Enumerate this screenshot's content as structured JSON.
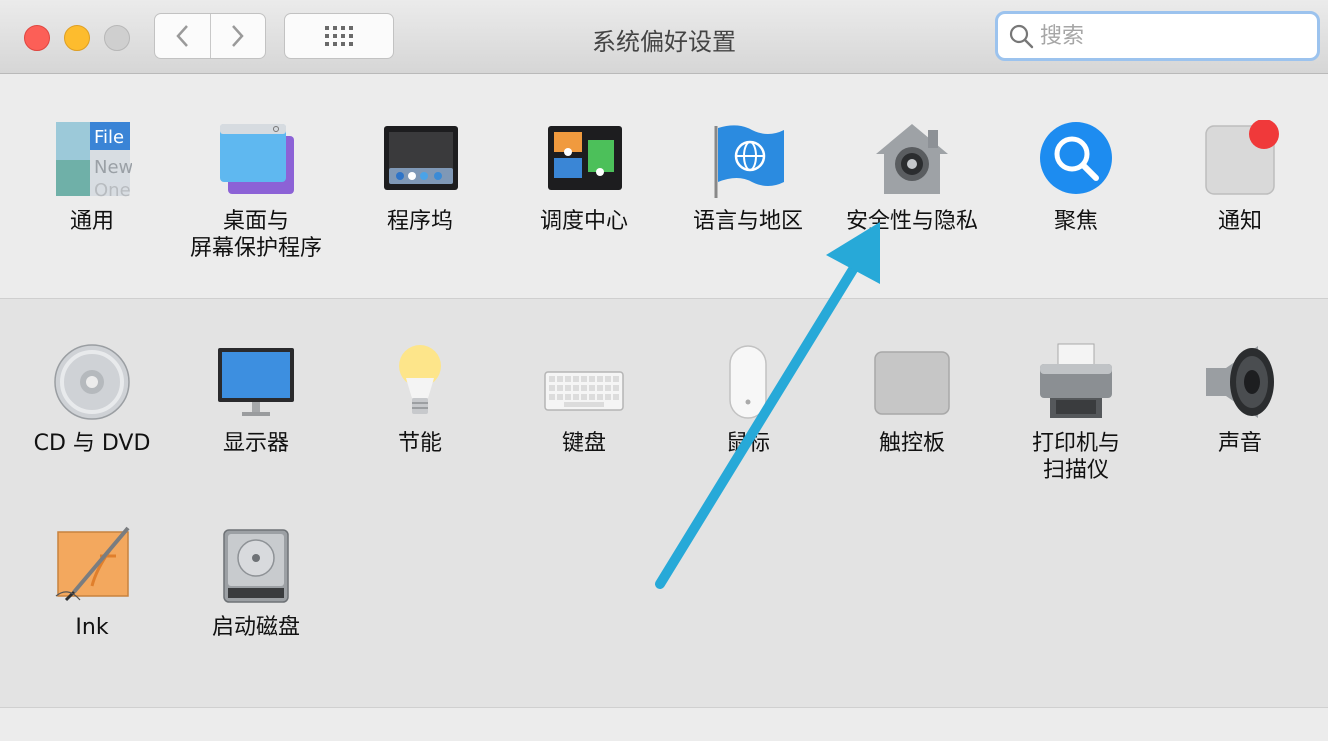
{
  "window": {
    "title": "系统偏好设置",
    "search_placeholder": "搜索"
  },
  "rows": [
    [
      {
        "id": "general",
        "label": "通用",
        "icon": "general-icon"
      },
      {
        "id": "desktop",
        "label": "桌面与\n屏幕保护程序",
        "icon": "desktop-screensaver-icon"
      },
      {
        "id": "dock",
        "label": "程序坞",
        "icon": "dock-icon"
      },
      {
        "id": "mission",
        "label": "调度中心",
        "icon": "mission-control-icon"
      },
      {
        "id": "language",
        "label": "语言与地区",
        "icon": "language-region-icon"
      },
      {
        "id": "security",
        "label": "安全性与隐私",
        "icon": "security-privacy-icon"
      },
      {
        "id": "spotlight",
        "label": "聚焦",
        "icon": "spotlight-icon"
      },
      {
        "id": "notifications",
        "label": "通知",
        "icon": "notifications-icon"
      }
    ],
    [
      {
        "id": "cd",
        "label": "CD 与 DVD",
        "icon": "cd-dvd-icon"
      },
      {
        "id": "display",
        "label": "显示器",
        "icon": "display-icon"
      },
      {
        "id": "energy",
        "label": "节能",
        "icon": "energy-saver-icon"
      },
      {
        "id": "keyboard",
        "label": "键盘",
        "icon": "keyboard-icon"
      },
      {
        "id": "mouse",
        "label": "鼠标",
        "icon": "mouse-icon"
      },
      {
        "id": "trackpad",
        "label": "触控板",
        "icon": "trackpad-icon"
      },
      {
        "id": "printer",
        "label": "打印机与\n扫描仪",
        "icon": "printer-scanner-icon"
      },
      {
        "id": "sound",
        "label": "声音",
        "icon": "sound-icon"
      }
    ],
    [
      {
        "id": "ink",
        "label": "Ink",
        "icon": "ink-icon"
      },
      {
        "id": "startup",
        "label": "启动磁盘",
        "icon": "startup-disk-icon"
      }
    ]
  ],
  "general_icon_text": [
    "File",
    "New",
    "One"
  ],
  "colors": {
    "annotation_arrow": "#27a9d8",
    "close": "#fc5f57",
    "minimize": "#fdbc2e"
  }
}
